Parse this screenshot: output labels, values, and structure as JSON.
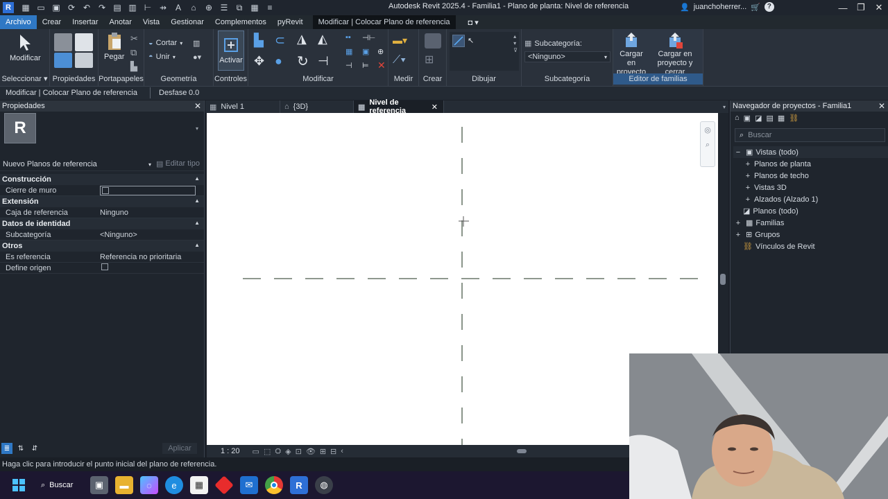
{
  "app": {
    "logo": "R",
    "title": "Autodesk Revit 2025.4 - Familia1 - Plano de planta: Nivel de referencia",
    "user": "juanchoherrer...",
    "qat_icons": [
      "open-icon",
      "save-icon",
      "sync-icon",
      "undo-icon",
      "redo-icon",
      "print-icon",
      "measure-icon",
      "text-icon",
      "3d-view-icon",
      "section-icon",
      "thin-lines-icon",
      "close-inactive-icon"
    ]
  },
  "menu": {
    "tabs": [
      "Archivo",
      "Crear",
      "Insertar",
      "Anotar",
      "Vista",
      "Gestionar",
      "Complementos",
      "pyRevit"
    ],
    "context_tab": "Modificar | Colocar Plano de referencia"
  },
  "ribbon": {
    "seleccionar": {
      "button": "Modificar",
      "label": "Seleccionar"
    },
    "propiedades": {
      "label": "Propiedades"
    },
    "portapapeles": {
      "button": "Pegar",
      "label": "Portapapeles"
    },
    "geometria": {
      "cut": "Cortar",
      "join": "Unir",
      "label": "Geometría"
    },
    "controles": {
      "button": "Activar",
      "label": "Controles"
    },
    "modificar": {
      "label": "Modificar"
    },
    "medir": {
      "label": "Medir"
    },
    "crear": {
      "label": "Crear"
    },
    "dibujar": {
      "label": "Dibujar"
    },
    "subcategoria": {
      "title": "Subcategoría:",
      "value": "<Ninguno>",
      "label": "Subcategoría"
    },
    "editor": {
      "load_project": "Cargar en proyecto",
      "load_project_close": "Cargar en proyecto y cerrar",
      "label": "Editor de familias"
    }
  },
  "optionsbar": {
    "context": "Modificar | Colocar Plano de referencia",
    "offset_label": "Desfase:",
    "offset_value": "0.0"
  },
  "properties": {
    "title": "Propiedades",
    "type_name": "Nuevo Planos de referencia",
    "edit_type": "Editar tipo",
    "apply": "Aplicar",
    "sections": [
      {
        "name": "Construcción",
        "rows": [
          {
            "k": "Cierre de muro",
            "v": "",
            "checkbox": true
          }
        ]
      },
      {
        "name": "Extensión",
        "rows": [
          {
            "k": "Caja de referencia",
            "v": "Ninguno"
          }
        ]
      },
      {
        "name": "Datos de identidad",
        "rows": [
          {
            "k": "Subcategoría",
            "v": "<Ninguno>"
          }
        ]
      },
      {
        "name": "Otros",
        "rows": [
          {
            "k": "Es referencia",
            "v": "Referencia no prioritaria"
          },
          {
            "k": "Define origen",
            "v": "",
            "checkbox": true
          }
        ]
      }
    ]
  },
  "view_tabs": [
    {
      "label": "Nivel 1",
      "icon": "floor-plan-icon",
      "active": false
    },
    {
      "label": "{3D}",
      "icon": "home-3d-icon",
      "active": false
    },
    {
      "label": "Nivel de referencia",
      "icon": "floor-plan-icon",
      "active": true
    }
  ],
  "viewbar": {
    "scale": "1 : 20"
  },
  "browser": {
    "title": "Navegador de proyectos - Familia1",
    "search_placeholder": "Buscar",
    "tree": [
      {
        "label": "Vistas (todo)",
        "toggle": "−",
        "level": 0,
        "icon": "views-icon"
      },
      {
        "label": "Planos de planta",
        "toggle": "+",
        "level": 1
      },
      {
        "label": "Planos de techo",
        "toggle": "+",
        "level": 1
      },
      {
        "label": "Vistas 3D",
        "toggle": "+",
        "level": 1
      },
      {
        "label": "Alzados (Alzado 1)",
        "toggle": "+",
        "level": 1
      },
      {
        "label": "Planos (todo)",
        "toggle": "",
        "level": 0,
        "icon": "sheets-icon"
      },
      {
        "label": "Familias",
        "toggle": "+",
        "level": 0,
        "icon": "families-icon"
      },
      {
        "label": "Grupos",
        "toggle": "+",
        "level": 0,
        "icon": "groups-icon"
      },
      {
        "label": "Vínculos de Revit",
        "toggle": "",
        "level": 0,
        "icon": "links-icon"
      }
    ]
  },
  "status": {
    "text": "Haga clic para introducir el punto inicial del plano de referencia."
  },
  "taskbar": {
    "search": "Buscar",
    "icons": [
      "windows-start-icon",
      "task-view-icon",
      "file-explorer-icon",
      "copilot-icon",
      "edge-icon",
      "store-icon",
      "app-red-icon",
      "mail-icon",
      "chrome-icon",
      "revit-icon",
      "chrome-dev-icon"
    ]
  },
  "colors": {
    "accent": "#2f78c4",
    "ref_plane": "#4a5a4a"
  }
}
